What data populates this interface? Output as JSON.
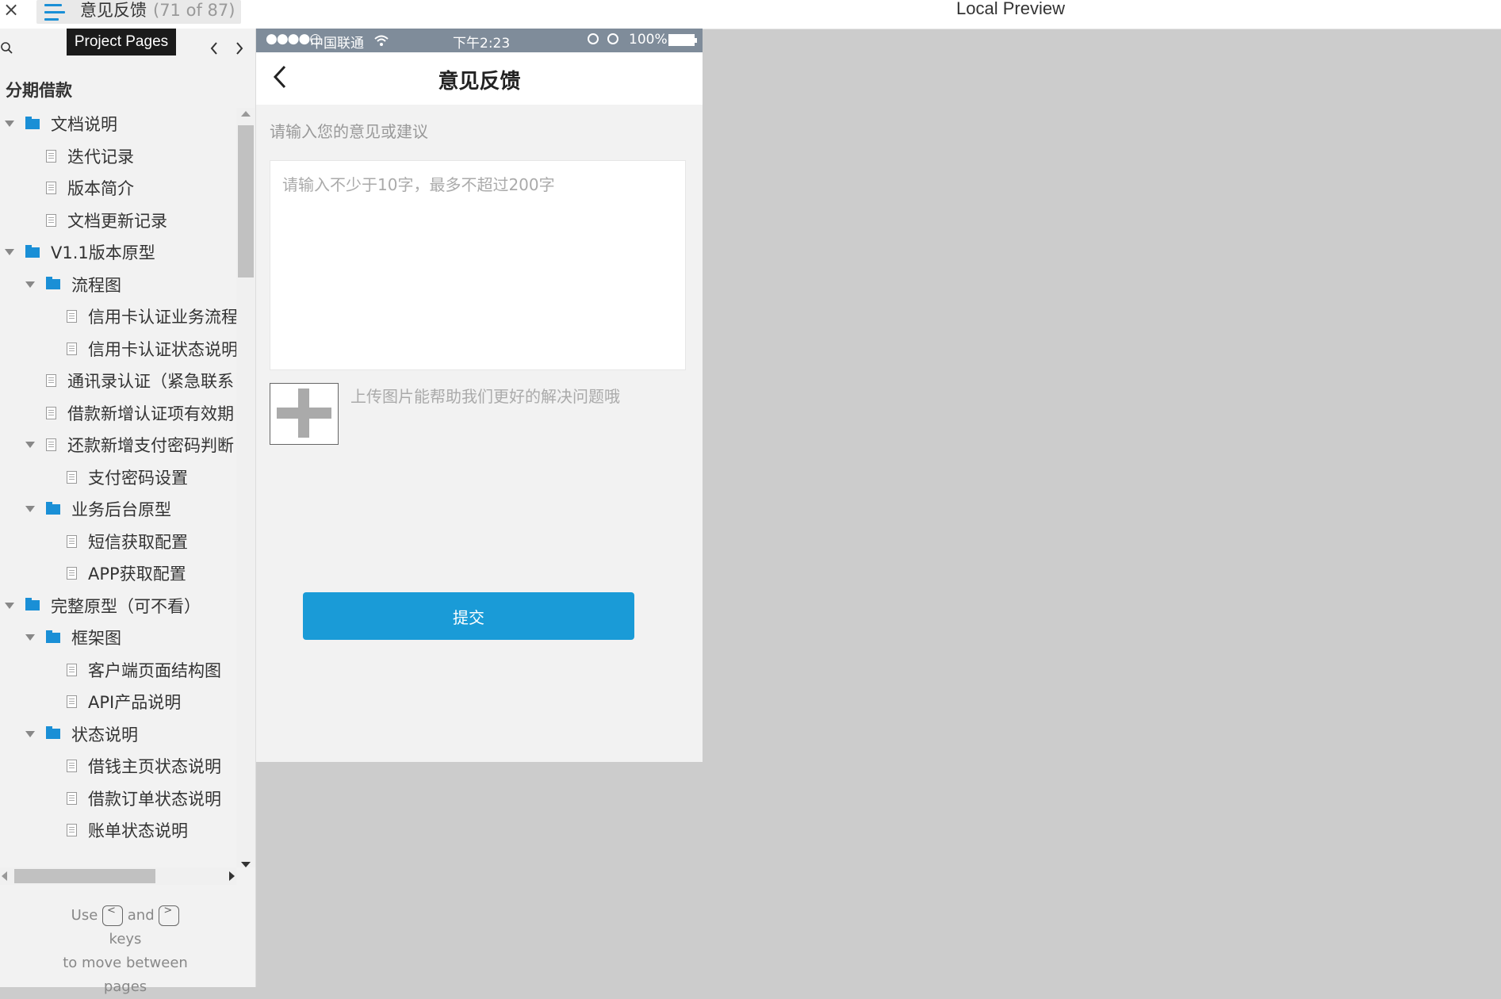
{
  "topbar": {
    "close_label": "×",
    "page_title": "意见反馈",
    "page_count": "(71 of 87)",
    "preview_label": "Local Preview"
  },
  "sidebar": {
    "tooltip": "Project Pages",
    "project_name": "分期借款",
    "tree": [
      {
        "label": "文档说明",
        "kind": "folder",
        "level": 0,
        "expanded": true
      },
      {
        "label": "迭代记录",
        "kind": "page",
        "level": 1
      },
      {
        "label": "版本简介",
        "kind": "page",
        "level": 1
      },
      {
        "label": "文档更新记录",
        "kind": "page",
        "level": 1
      },
      {
        "label": "V1.1版本原型",
        "kind": "folder",
        "level": 0,
        "expanded": true
      },
      {
        "label": "流程图",
        "kind": "folder",
        "level": 1,
        "expanded": true
      },
      {
        "label": "信用卡认证业务流程",
        "kind": "page",
        "level": 2
      },
      {
        "label": "信用卡认证状态说明",
        "kind": "page",
        "level": 2
      },
      {
        "label": "通讯录认证（紧急联系",
        "kind": "page",
        "level": 1
      },
      {
        "label": "借款新增认证项有效期",
        "kind": "page",
        "level": 1
      },
      {
        "label": "还款新增支付密码判断",
        "kind": "page",
        "level": 1,
        "expanded": true
      },
      {
        "label": "支付密码设置",
        "kind": "page",
        "level": 2
      },
      {
        "label": "业务后台原型",
        "kind": "folder",
        "level": 1,
        "expanded": true
      },
      {
        "label": "短信获取配置",
        "kind": "page",
        "level": 2
      },
      {
        "label": "APP获取配置",
        "kind": "page",
        "level": 2
      },
      {
        "label": "完整原型（可不看）",
        "kind": "folder",
        "level": 0,
        "expanded": true
      },
      {
        "label": "框架图",
        "kind": "folder",
        "level": 1,
        "expanded": true
      },
      {
        "label": "客户端页面结构图",
        "kind": "page",
        "level": 2
      },
      {
        "label": "API产品说明",
        "kind": "page",
        "level": 2
      },
      {
        "label": "状态说明",
        "kind": "folder",
        "level": 1,
        "expanded": true
      },
      {
        "label": "借钱主页状态说明",
        "kind": "page",
        "level": 2
      },
      {
        "label": "借款订单状态说明",
        "kind": "page",
        "level": 2
      },
      {
        "label": "账单状态说明",
        "kind": "page",
        "level": 2
      }
    ],
    "hint": {
      "use": "Use",
      "and": "and",
      "prev_key": "<",
      "next_key": ">",
      "line2": "keys",
      "line3": "to move between",
      "line4": "pages"
    }
  },
  "phone": {
    "status": {
      "signal": "●●●●○",
      "carrier": "中国联通",
      "time": "下午2:23",
      "battery": "100%"
    },
    "nav_title": "意见反馈",
    "prompt_label": "请输入您的意见或建议",
    "feedback_placeholder": "请输入不少于10字，最多不超过200字",
    "upload_hint": "上传图片能帮助我们更好的解决问题哦",
    "submit_label": "提交"
  },
  "colors": {
    "accent": "#1a9bd7",
    "folder": "#1a8fd6",
    "statusbar": "#7f8c9a",
    "canvas": "#cccccc"
  }
}
